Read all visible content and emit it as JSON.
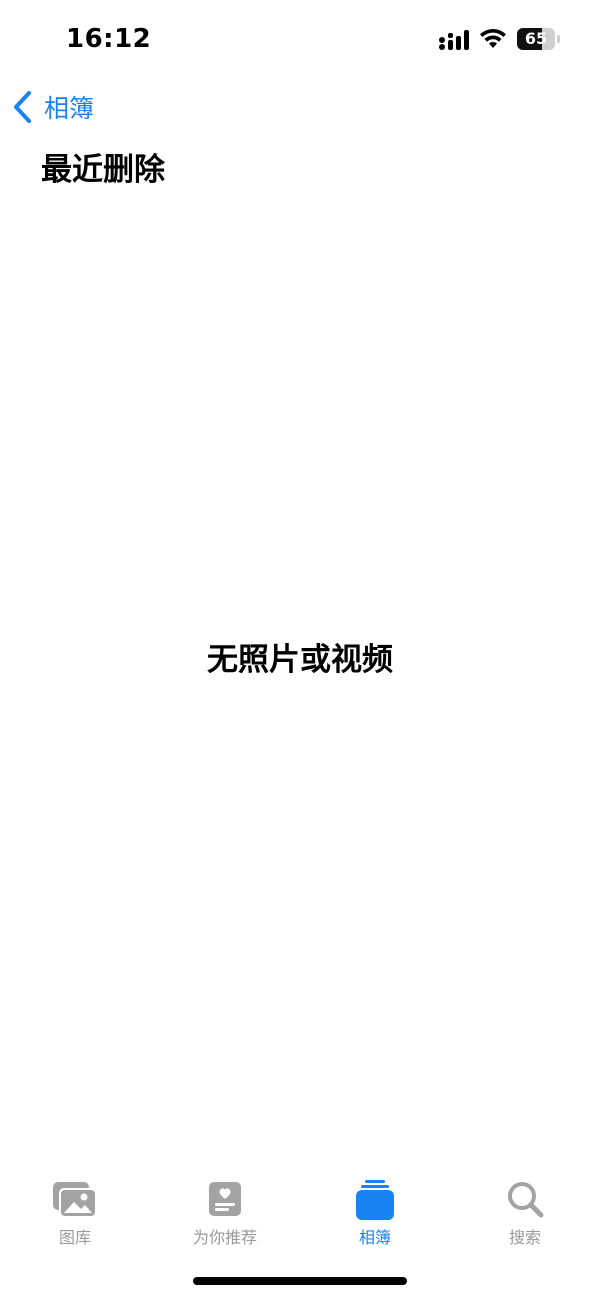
{
  "status_bar": {
    "time": "16:12",
    "battery_level": "65",
    "battery_fraction": 0.65,
    "icons": [
      "signal-icon",
      "wifi-icon",
      "battery-icon"
    ]
  },
  "nav": {
    "back_label": "相簿",
    "back_icon": "chevron-left-icon"
  },
  "page": {
    "title": "最近删除",
    "empty_message": "无照片或视频"
  },
  "tab_bar": {
    "tabs": [
      {
        "label": "图库",
        "icon": "photo-library-icon",
        "active": false
      },
      {
        "label": "为你推荐",
        "icon": "for-you-icon",
        "active": false
      },
      {
        "label": "相簿",
        "icon": "albums-icon",
        "active": true
      },
      {
        "label": "搜索",
        "icon": "search-icon",
        "active": false
      }
    ]
  },
  "colors": {
    "accent": "#1a82f2",
    "inactive": "#9a9a9a",
    "text": "#000000",
    "background": "#ffffff"
  }
}
